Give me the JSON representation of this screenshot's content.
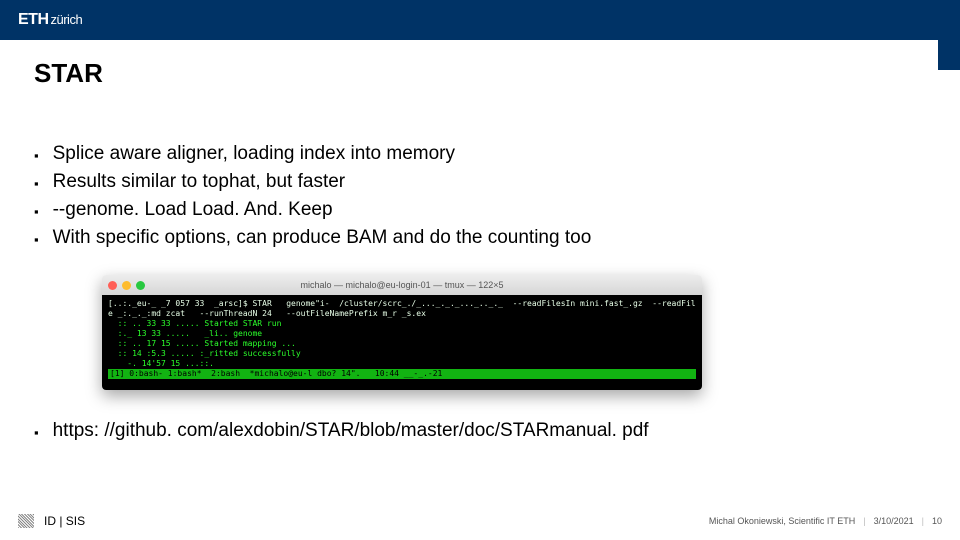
{
  "header": {
    "logo_main": "ETH",
    "logo_sub": "zürich"
  },
  "title": "STAR",
  "bullets": [
    "Splice aware aligner, loading index into memory",
    "Results similar to tophat, but faster",
    "--genome. Load Load. And. Keep",
    "With specific options, can produce BAM and do the counting too"
  ],
  "terminal": {
    "title": "michalo — michalo@eu-login-01 — tmux — 122×5",
    "lines": [
      "[..:._eu-_ _7 057 33  _arsc]$ STAR   genome\"i-  /cluster/scrc_./_..._._._..._.._._  --readFilesIn mini.fast_.gz  --readFil",
      "e _:._._:md zcat   --runThreadN 24   --outFileNamePrefix m_r _s.ex",
      "  :: .. 33 33 ..... Started STAR run",
      "  :._ 13 33 .....   _li.. genome",
      "  :: .. 17 15 ..... Started mapping ...",
      "  :: 14 :5.3 ..... :_ritted successfully",
      "    -. 14'57 15 ...::."
    ],
    "status": "[1] 0:bash- 1:bash*  2:bash  *michalo@eu-l dbo? 14\".   10:44 __-_.-21"
  },
  "link": "https: //github. com/alexdobin/STAR/blob/master/doc/STARmanual. pdf",
  "footer": {
    "dept": "ID | SIS",
    "author": "Michal Okoniewski, Scientific IT ETH",
    "date": "3/10/2021",
    "page": "10"
  }
}
